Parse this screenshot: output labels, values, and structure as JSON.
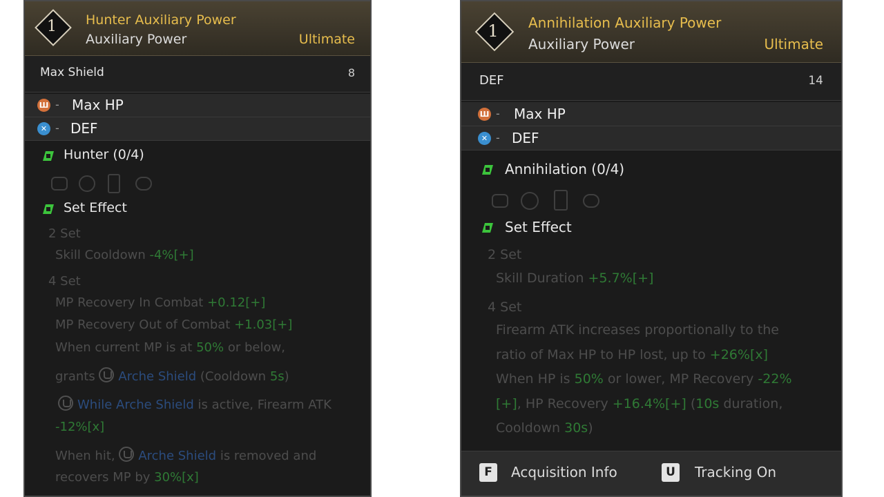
{
  "left": {
    "rank": "1",
    "title": "Hunter Auxiliary Power",
    "subtitle": "Auxiliary Power",
    "grade": "Ultimate",
    "stat": {
      "name": "Max Shield",
      "value": "8"
    },
    "types": [
      {
        "dash": "-",
        "label": "Max HP",
        "icon": "max-hp-icon"
      },
      {
        "dash": "-",
        "label": "DEF",
        "icon": "def-icon"
      }
    ],
    "set_name": "Hunter (0/4)",
    "set_effect_label": "Set Effect",
    "set2": {
      "label": "2 Set",
      "line1_text": "Skill Cooldown ",
      "line1_value": "-4%[+]"
    },
    "set4": {
      "label": "4 Set",
      "l1_text": "MP Recovery In Combat ",
      "l1_value": "+0.12[+]",
      "l2_text": "MP Recovery Out of Combat ",
      "l2_value": "+1.03[+]",
      "l3_a": "When current MP is at ",
      "l3_value": "50%",
      "l3_b": " or below,",
      "l4_a": "grants ",
      "l4_link": "Arche Shield",
      "l4_b": " (Cooldown ",
      "l4_value": "5s",
      "l4_c": ")",
      "l5_link": "While Arche Shield",
      "l5_b": " is active, Firearm ATK",
      "l6_value": "-12%[x]",
      "l7_a": "When hit, ",
      "l7_link": "Arche Shield",
      "l7_b": " is removed and",
      "l8_a": "recovers MP by ",
      "l8_value": "30%[x]"
    }
  },
  "right": {
    "rank": "1",
    "title": "Annihilation Auxiliary Power",
    "subtitle": "Auxiliary Power",
    "grade": "Ultimate",
    "stat": {
      "name": "DEF",
      "value": "14"
    },
    "types": [
      {
        "dash": "-",
        "label": "Max HP",
        "icon": "max-hp-icon"
      },
      {
        "dash": "-",
        "label": "DEF",
        "icon": "def-icon"
      }
    ],
    "set_name": "Annihilation (0/4)",
    "set_effect_label": "Set Effect",
    "set2": {
      "label": "2 Set",
      "line1_text": "Skill Duration ",
      "line1_value": "+5.7%[+]"
    },
    "set4": {
      "label": "4 Set",
      "l1": "Firearm ATK increases proportionally to the",
      "l2_a": "ratio of Max HP to HP lost, up to ",
      "l2_value": "+26%[x]",
      "l3_a": "When HP is ",
      "l3_v1": "50%",
      "l3_b": " or lower, MP Recovery ",
      "l3_v2": "-22%",
      "l4_v1": "[+]",
      "l4_a": ", HP Recovery ",
      "l4_v2": "+16.4%[+]",
      "l4_b": " (",
      "l4_v3": "10s",
      "l4_c": " duration,",
      "l5_a": "Cooldown ",
      "l5_v": "30s",
      "l5_b": ")"
    },
    "footer": {
      "key1": "F",
      "label1": "Acquisition Info",
      "key2": "U",
      "label2": "Tracking On"
    }
  }
}
